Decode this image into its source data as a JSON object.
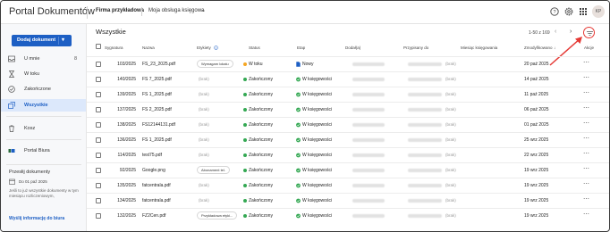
{
  "header": {
    "app_title": "Portal Dokumentów",
    "company": "Firma przykładowa",
    "accountant": "Moja obsługa księgowa",
    "avatar": "KP",
    "icons": [
      "help-icon",
      "settings-icon",
      "apps-grid-icon"
    ]
  },
  "sidebar": {
    "add_button": "Dodaj dokument",
    "items": [
      {
        "label": "U mnie",
        "count": "8",
        "icon": "inbox-icon"
      },
      {
        "label": "W toku",
        "count": "",
        "icon": "hourglass-icon"
      },
      {
        "label": "Zakończone",
        "count": "",
        "icon": "check-circle-icon"
      },
      {
        "label": "Wszystkie",
        "count": "",
        "icon": "stack-icon",
        "active": true
      },
      {
        "label": "Kosz",
        "count": "",
        "icon": "trash-icon"
      },
      {
        "label": "Portal Biura",
        "count": "",
        "icon": "portal-icon"
      }
    ],
    "card": {
      "title": "Przesłij dokumenty",
      "date": "Do 01 paź 2025",
      "text": "Jeśli to już wszystkie dokumenty w tym miesiącu rozliczeniowym,",
      "link": "Wyślij informację do biura"
    }
  },
  "main": {
    "title": "Wszystkie",
    "pager": "1-50 z 169",
    "columns": {
      "sygnatura": "Sygnatura",
      "nazwa": "Nazwa",
      "etykiety": "Etykiety",
      "status": "Status",
      "etap": "Etap",
      "dodal": "Dodał(a)",
      "przypisany": "Przypisany do",
      "miesiac": "Miesiąc księgowania",
      "zmodyfikowano": "Zmodyfikowano",
      "akcje": "Akcje"
    },
    "rows": [
      {
        "sygn": "103/2025",
        "name": "FS_23_2025.pdf",
        "label": "Wymagam lokalu",
        "status": "W toku",
        "status_color": "#f5a623",
        "etap": "Nowy",
        "mies": "(brak)",
        "date": "20 paź 2025"
      },
      {
        "sygn": "140/2025",
        "name": "FS 7_2025.pdf",
        "label": "(brak)",
        "status": "Zakończony",
        "status_color": "#34a853",
        "etap": "W księgowości",
        "mies": "(brak)",
        "date": "14 paź 2025"
      },
      {
        "sygn": "139/2025",
        "name": "FS 1_2025.pdf",
        "label": "(brak)",
        "status": "Zakończony",
        "status_color": "#34a853",
        "etap": "W księgowości",
        "mies": "(brak)",
        "date": "11 paź 2025"
      },
      {
        "sygn": "137/2025",
        "name": "FS 2_2025.pdf",
        "label": "(brak)",
        "status": "Zakończony",
        "status_color": "#34a853",
        "etap": "W księgowości",
        "mies": "(brak)",
        "date": "06 paź 2025"
      },
      {
        "sygn": "138/2025",
        "name": "FS12144131.pdf",
        "label": "(brak)",
        "status": "Zakończony",
        "status_color": "#34a853",
        "etap": "W księgowości",
        "mies": "(brak)",
        "date": "01 paź 2025"
      },
      {
        "sygn": "136/2025",
        "name": "FS 1_2025.pdf",
        "label": "(brak)",
        "status": "Zakończony",
        "status_color": "#34a853",
        "etap": "W księgowości",
        "mies": "(brak)",
        "date": "25 wrz 2025"
      },
      {
        "sygn": "114/2025",
        "name": "test75.pdf",
        "label": "(brak)",
        "status": "Zakończony",
        "status_color": "#34a853",
        "etap": "W księgowości",
        "mies": "(brak)",
        "date": "22 wrz 2025"
      },
      {
        "sygn": "92/2025",
        "name": "Google.png",
        "label": "Abonament tel.",
        "status": "Zakończony",
        "status_color": "#34a853",
        "etap": "W księgowości",
        "mies": "(brak)",
        "date": "19 wrz 2025"
      },
      {
        "sygn": "135/2025",
        "name": "fatcentrala.pdf",
        "label": "(brak)",
        "status": "Zakończony",
        "status_color": "#34a853",
        "etap": "W księgowości",
        "mies": "(brak)",
        "date": "19 wrz 2025"
      },
      {
        "sygn": "134/2025",
        "name": "fatcentrala.pdf",
        "label": "(brak)",
        "status": "Zakończony",
        "status_color": "#34a853",
        "etap": "W księgowości",
        "mies": "(brak)",
        "date": "19 wrz 2025"
      },
      {
        "sygn": "132/2025",
        "name": "FZ2Cen.pdf",
        "label": "Przykładowa etyki...",
        "status": "Zakończony",
        "status_color": "#34a853",
        "etap": "W księgowości",
        "mies": "(brak)",
        "date": "19 wrz 2025"
      }
    ]
  },
  "colors": {
    "primary": "#1d5fc4",
    "active_nav_bg": "#dce8fb",
    "status_in_progress": "#f5a623",
    "status_done": "#34a853",
    "annotation_red": "#e53935"
  }
}
